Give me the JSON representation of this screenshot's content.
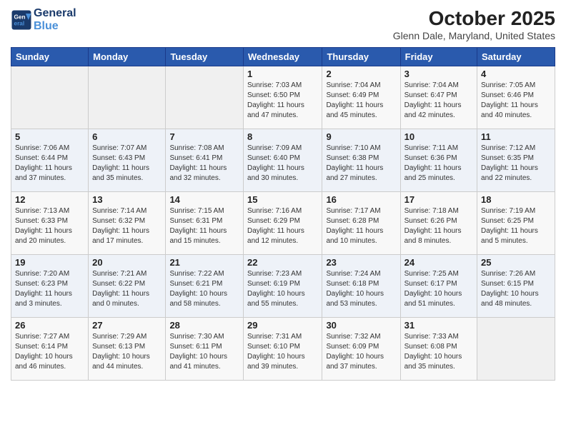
{
  "header": {
    "logo_line1": "General",
    "logo_line2": "Blue",
    "month_year": "October 2025",
    "location": "Glenn Dale, Maryland, United States"
  },
  "weekdays": [
    "Sunday",
    "Monday",
    "Tuesday",
    "Wednesday",
    "Thursday",
    "Friday",
    "Saturday"
  ],
  "weeks": [
    [
      {
        "day": "",
        "info": ""
      },
      {
        "day": "",
        "info": ""
      },
      {
        "day": "",
        "info": ""
      },
      {
        "day": "1",
        "info": "Sunrise: 7:03 AM\nSunset: 6:50 PM\nDaylight: 11 hours\nand 47 minutes."
      },
      {
        "day": "2",
        "info": "Sunrise: 7:04 AM\nSunset: 6:49 PM\nDaylight: 11 hours\nand 45 minutes."
      },
      {
        "day": "3",
        "info": "Sunrise: 7:04 AM\nSunset: 6:47 PM\nDaylight: 11 hours\nand 42 minutes."
      },
      {
        "day": "4",
        "info": "Sunrise: 7:05 AM\nSunset: 6:46 PM\nDaylight: 11 hours\nand 40 minutes."
      }
    ],
    [
      {
        "day": "5",
        "info": "Sunrise: 7:06 AM\nSunset: 6:44 PM\nDaylight: 11 hours\nand 37 minutes."
      },
      {
        "day": "6",
        "info": "Sunrise: 7:07 AM\nSunset: 6:43 PM\nDaylight: 11 hours\nand 35 minutes."
      },
      {
        "day": "7",
        "info": "Sunrise: 7:08 AM\nSunset: 6:41 PM\nDaylight: 11 hours\nand 32 minutes."
      },
      {
        "day": "8",
        "info": "Sunrise: 7:09 AM\nSunset: 6:40 PM\nDaylight: 11 hours\nand 30 minutes."
      },
      {
        "day": "9",
        "info": "Sunrise: 7:10 AM\nSunset: 6:38 PM\nDaylight: 11 hours\nand 27 minutes."
      },
      {
        "day": "10",
        "info": "Sunrise: 7:11 AM\nSunset: 6:36 PM\nDaylight: 11 hours\nand 25 minutes."
      },
      {
        "day": "11",
        "info": "Sunrise: 7:12 AM\nSunset: 6:35 PM\nDaylight: 11 hours\nand 22 minutes."
      }
    ],
    [
      {
        "day": "12",
        "info": "Sunrise: 7:13 AM\nSunset: 6:33 PM\nDaylight: 11 hours\nand 20 minutes."
      },
      {
        "day": "13",
        "info": "Sunrise: 7:14 AM\nSunset: 6:32 PM\nDaylight: 11 hours\nand 17 minutes."
      },
      {
        "day": "14",
        "info": "Sunrise: 7:15 AM\nSunset: 6:31 PM\nDaylight: 11 hours\nand 15 minutes."
      },
      {
        "day": "15",
        "info": "Sunrise: 7:16 AM\nSunset: 6:29 PM\nDaylight: 11 hours\nand 12 minutes."
      },
      {
        "day": "16",
        "info": "Sunrise: 7:17 AM\nSunset: 6:28 PM\nDaylight: 11 hours\nand 10 minutes."
      },
      {
        "day": "17",
        "info": "Sunrise: 7:18 AM\nSunset: 6:26 PM\nDaylight: 11 hours\nand 8 minutes."
      },
      {
        "day": "18",
        "info": "Sunrise: 7:19 AM\nSunset: 6:25 PM\nDaylight: 11 hours\nand 5 minutes."
      }
    ],
    [
      {
        "day": "19",
        "info": "Sunrise: 7:20 AM\nSunset: 6:23 PM\nDaylight: 11 hours\nand 3 minutes."
      },
      {
        "day": "20",
        "info": "Sunrise: 7:21 AM\nSunset: 6:22 PM\nDaylight: 11 hours\nand 0 minutes."
      },
      {
        "day": "21",
        "info": "Sunrise: 7:22 AM\nSunset: 6:21 PM\nDaylight: 10 hours\nand 58 minutes."
      },
      {
        "day": "22",
        "info": "Sunrise: 7:23 AM\nSunset: 6:19 PM\nDaylight: 10 hours\nand 55 minutes."
      },
      {
        "day": "23",
        "info": "Sunrise: 7:24 AM\nSunset: 6:18 PM\nDaylight: 10 hours\nand 53 minutes."
      },
      {
        "day": "24",
        "info": "Sunrise: 7:25 AM\nSunset: 6:17 PM\nDaylight: 10 hours\nand 51 minutes."
      },
      {
        "day": "25",
        "info": "Sunrise: 7:26 AM\nSunset: 6:15 PM\nDaylight: 10 hours\nand 48 minutes."
      }
    ],
    [
      {
        "day": "26",
        "info": "Sunrise: 7:27 AM\nSunset: 6:14 PM\nDaylight: 10 hours\nand 46 minutes."
      },
      {
        "day": "27",
        "info": "Sunrise: 7:29 AM\nSunset: 6:13 PM\nDaylight: 10 hours\nand 44 minutes."
      },
      {
        "day": "28",
        "info": "Sunrise: 7:30 AM\nSunset: 6:11 PM\nDaylight: 10 hours\nand 41 minutes."
      },
      {
        "day": "29",
        "info": "Sunrise: 7:31 AM\nSunset: 6:10 PM\nDaylight: 10 hours\nand 39 minutes."
      },
      {
        "day": "30",
        "info": "Sunrise: 7:32 AM\nSunset: 6:09 PM\nDaylight: 10 hours\nand 37 minutes."
      },
      {
        "day": "31",
        "info": "Sunrise: 7:33 AM\nSunset: 6:08 PM\nDaylight: 10 hours\nand 35 minutes."
      },
      {
        "day": "",
        "info": ""
      }
    ]
  ]
}
